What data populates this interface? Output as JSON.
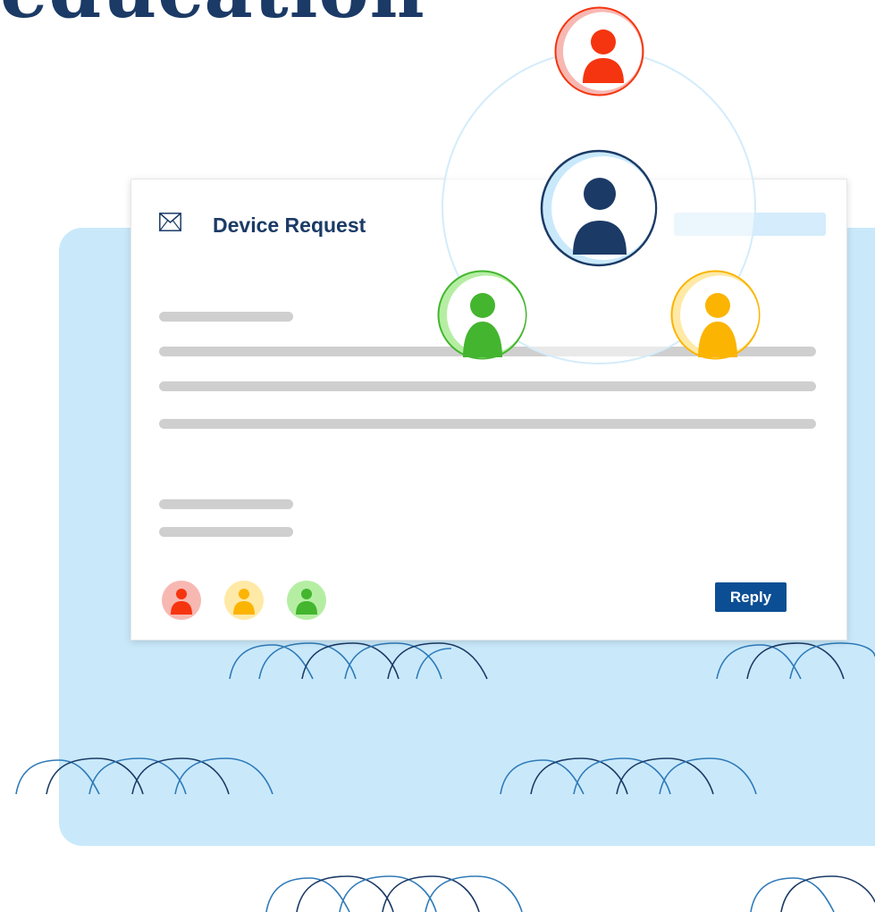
{
  "headline": "education",
  "card": {
    "title": "Device Request",
    "icons": {
      "mail": "envelope-icon"
    },
    "participants": [
      {
        "name": "red-user",
        "color": "#f5350f",
        "light": "#f7b8b2"
      },
      {
        "name": "yellow-user",
        "color": "#fbb402",
        "light": "#ffe9a6"
      },
      {
        "name": "green-user",
        "color": "#44b52f",
        "light": "#b5eea3"
      }
    ],
    "reply_label": "Reply"
  },
  "colors": {
    "navy": "#1b3a66",
    "brand_blue": "#0c4e94",
    "light_blue": "#c9e9fb",
    "placeholder_gray": "#cfcfcf"
  }
}
